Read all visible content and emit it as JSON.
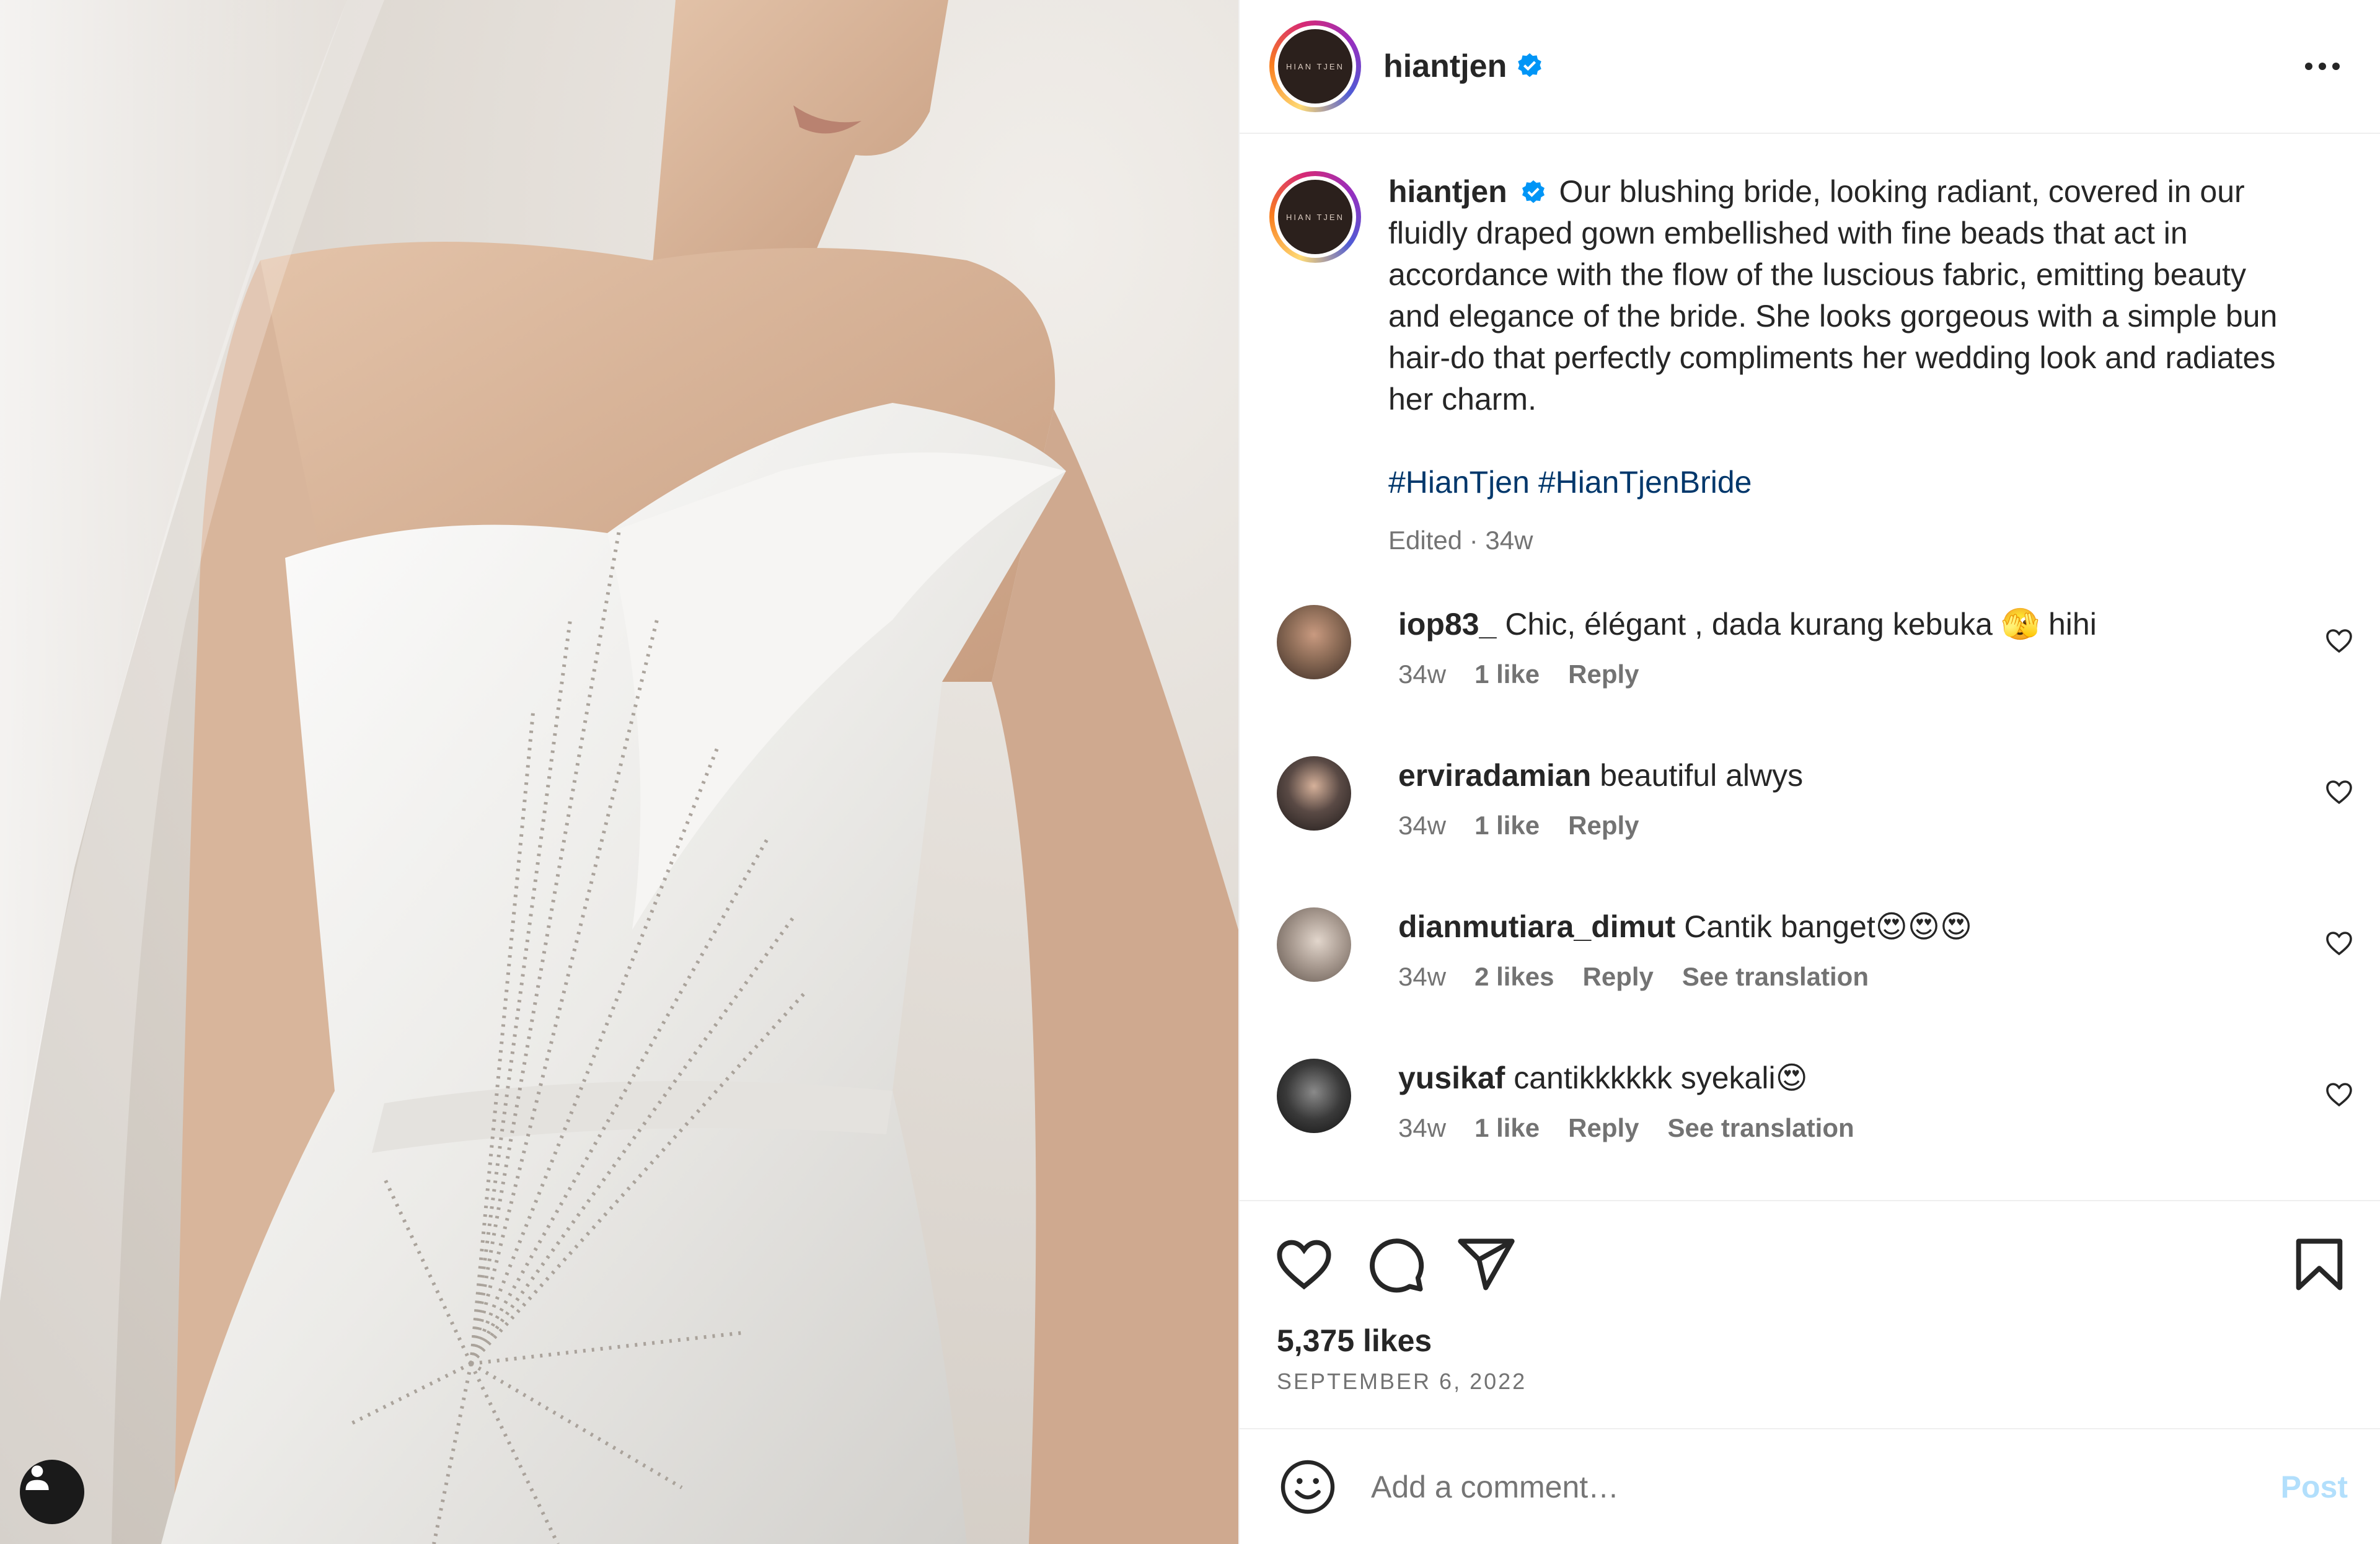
{
  "post": {
    "username": "hiantjen",
    "logo_text": "HIAN TJEN",
    "caption": "Our blushing bride, looking radiant, covered in our fluidly draped gown embellished with fine beads that act in accordance with the flow of the luscious fabric, emitting beauty and elegance of the bride. She looks gorgeous with a simple bun hair-do that perfectly compliments her wedding look and radiates her charm.",
    "hashtags": [
      "#HianTjen",
      "#HianTjenBride"
    ],
    "edited": "Edited · 34w",
    "likes": "5,375 likes",
    "date": "SEPTEMBER 6, 2022"
  },
  "comments": [
    {
      "user": "iop83_",
      "text": "Chic, élégant , dada kurang kebuka 🫣 hihi",
      "ago": "34w",
      "likes": "1 like",
      "reply": "Reply",
      "translate": "",
      "avatar_color": "#8a6a55"
    },
    {
      "user": "erviradamian",
      "text": "beautiful alwys",
      "ago": "34w",
      "likes": "1 like",
      "reply": "Reply",
      "translate": "",
      "avatar_color": "#5a4a45"
    },
    {
      "user": "dianmutiara_dimut",
      "text": "Cantik banget😍😍😍",
      "ago": "34w",
      "likes": "2 likes",
      "reply": "Reply",
      "translate": "See translation",
      "avatar_color": "#a89a90"
    },
    {
      "user": "yusikaf",
      "text": "cantikkkkkk syekali😍",
      "ago": "34w",
      "likes": "1 like",
      "reply": "Reply",
      "translate": "See translation",
      "avatar_color": "#3a3a3a"
    }
  ],
  "add_comment": {
    "placeholder": "Add a comment…",
    "post_label": "Post"
  },
  "icons": {
    "like": "heart-icon",
    "comment": "comment-bubble-icon",
    "share": "paper-plane-icon",
    "save": "bookmark-icon",
    "more": "more-dots-icon",
    "emoji": "emoji-smile-icon",
    "verified": "verified-badge-icon",
    "user_tag": "person-tag-icon"
  },
  "colors": {
    "link": "#00376b",
    "verified": "#0095f6",
    "post_disabled": "#b2dffc",
    "muted": "#737373"
  }
}
